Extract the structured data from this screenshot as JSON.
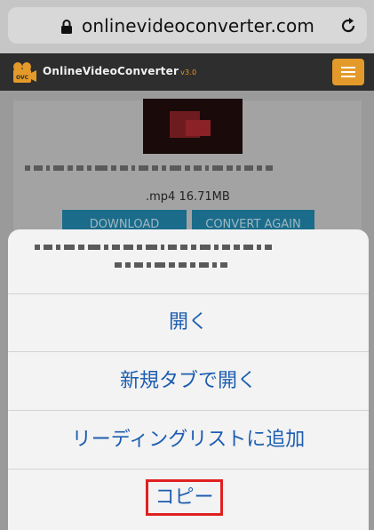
{
  "browser": {
    "url": "onlinevideoconverter.com",
    "lock_icon": "lock-icon",
    "reload_icon": "reload-icon"
  },
  "site": {
    "brand": "OnlineVideoConverter",
    "version": "v3.0",
    "logo_icon": "film-camera-icon",
    "menu_icon": "hamburger-icon",
    "accent_color": "#e49a2a"
  },
  "result": {
    "file_info": ".mp4   16.71MB",
    "download_label": "DOWNLOAD",
    "convert_again_label": "CONVERT AGAIN"
  },
  "action_sheet": {
    "items": [
      {
        "label": "開く"
      },
      {
        "label": "新規タブで開く"
      },
      {
        "label": "リーディングリストに追加"
      },
      {
        "label": "コピー"
      }
    ],
    "highlight_color": "#e02020",
    "text_color": "#1c5db0"
  }
}
